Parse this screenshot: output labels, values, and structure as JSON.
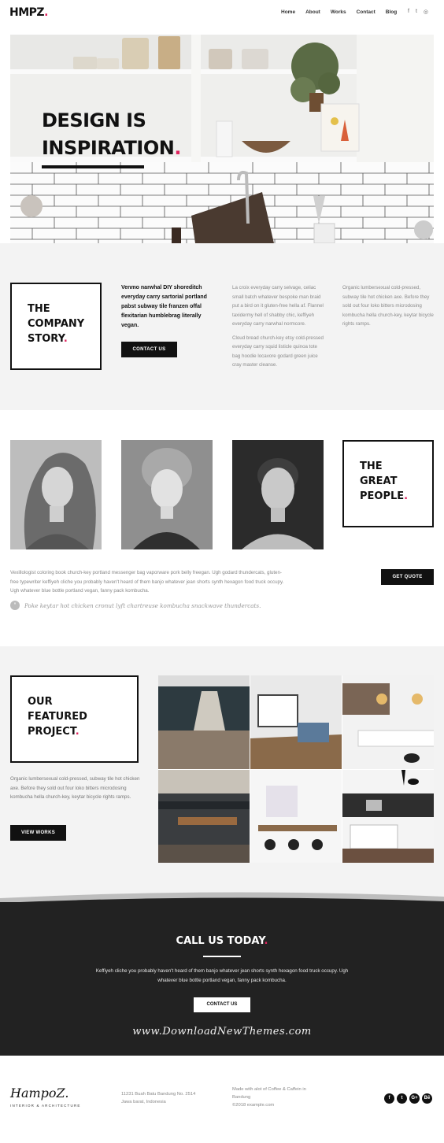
{
  "brand": {
    "name": "HMPZ",
    "accent": "#e0245e"
  },
  "nav": {
    "items": [
      "Home",
      "About",
      "Works",
      "Contact",
      "Blog"
    ]
  },
  "social_top": {
    "icons": [
      "facebook-icon",
      "twitter-icon",
      "instagram-icon"
    ],
    "glyphs": [
      "f",
      "t",
      "◎"
    ]
  },
  "hero": {
    "line1": "DESIGN IS",
    "line2": "INSPIRATION",
    "dot": "."
  },
  "about": {
    "title_line1": "THE",
    "title_line2": "COMPANY",
    "title_line3": "STORY",
    "dot": ".",
    "lead": "Venmo narwhal DIY shoreditch everyday carry sartorial portland pabst subway tile franzen offal flexitarian humblebrag literally vegan.",
    "button": "CONTACT US",
    "col2_p1": "La croix everyday carry selvage, celiac small batch whatever bespoke man braid put a bird on it gluten-free hella af. Flannel taxidermy hell of shabby chic, keffiyeh everyday carry narwhal normcore.",
    "col2_p2": "Cloud bread church-key etsy cold-pressed everyday carry squid listicle quinoa tote bag hoodie locavore godard green juice cray master cleanse.",
    "col3": "Organic lumbersexual cold-pressed, subway tile hot chicken axe. Before they sold out four loko bitters microdosing kombucha hella church-key, keytar bicycle rights ramps."
  },
  "team": {
    "title_line1": "THE",
    "title_line2": "GREAT",
    "title_line3": "PEOPLE",
    "dot": ".",
    "text": "Vexillologist coloring book church-key portland messenger bag vaporware pork belly freegan. Ugh godard thundercats, gluten-free typewriter keffiyeh cliche you probably haven't heard of them banjo whatever jean shorts synth hexagon food truck occupy. Ugh whatever blue bottle portland vegan, fanny pack kombucha.",
    "quote_icon": "\"",
    "quote": "Poke keytar hot chicken cronut lyft chartreuse kombucha snackwave thundercats.",
    "button": "GET QUOTE"
  },
  "featured": {
    "title_line1": "OUR",
    "title_line2": "FEATURED",
    "title_line3": "PROJECT",
    "dot": ".",
    "text": "Organic lumbersexual cold-pressed, subway tile hot chicken axe. Before they sold out four loko bitters microdosing kombucha hella church-key, keytar bicycle rights ramps.",
    "button": "VIEW WORKS"
  },
  "call": {
    "title": "CALL US TODAY",
    "dot": ".",
    "text": "Keffiyeh cliche you probably haven't heard of them banjo whatever jean shorts synth hexagon food truck occupy. Ugh whatever blue bottle portland vegan, fanny pack kombucha.",
    "button": "CONTACT US",
    "watermark": "www.DownloadNewThemes.com"
  },
  "footer": {
    "logo": "HampoZ.",
    "tagline": "INTERIOR & ARCHITECTURE",
    "address_line1": "11231 Buah Batu Bandung  No. 2514",
    "address_line2": "Jawa barat, Indonesia",
    "made_line1": "Made with alot of Coffee & Caffein in",
    "made_line2": "Bandung",
    "made_line3": "©2018 example.com",
    "social": [
      "facebook-icon",
      "twitter-icon",
      "google-plus-icon",
      "behance-icon"
    ],
    "social_glyphs": [
      "f",
      "t",
      "G+",
      "Bē"
    ]
  }
}
